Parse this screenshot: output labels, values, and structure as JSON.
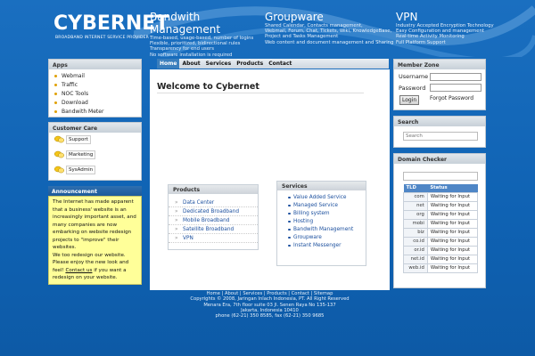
{
  "header": {
    "logo": "CYBERNET",
    "tagline": "BROADBAND INTERNET SERVICE PROVIDER",
    "columns": [
      {
        "title": "Bandwith Management",
        "lines": [
          "Time-based, usage-based, number of logins",
          "Flexible, prioritized, bidirectional rules",
          "Transparency for end users",
          "No software installation is required"
        ]
      },
      {
        "title": "Groupware",
        "lines": [
          "Shared Calendar, Contacts management,",
          "Webmail, Forum, Chat, Tickets, Wiki, KnowledgeBase,",
          "Project and Tasks Management",
          "Web content and document management and Sharing"
        ]
      },
      {
        "title": "VPN",
        "lines": [
          "Industry Accepted Encryption Technology",
          "Easy Configuration and management",
          "Real-time Activity Monitoring",
          "Full Platform Support"
        ]
      }
    ]
  },
  "nav": [
    "Home",
    "About",
    "Services",
    "Products",
    "Contact"
  ],
  "apps": {
    "title": "Apps",
    "items": [
      "Webmail",
      "Traffic",
      "NOC Tools",
      "Download",
      "Bandwith Meter"
    ]
  },
  "care": {
    "title": "Customer Care",
    "items": [
      "Support",
      "Marketing",
      "SysAdmin"
    ]
  },
  "announcement": {
    "title": "Announcement",
    "lines": [
      "The Internet has made apparent",
      "that a business' website is an",
      "increasingly important asset, and",
      "many companies are now",
      "embarking on website redesign",
      "projects to \"improve\" their",
      "websites.",
      "We too redesign our website.",
      "Please enjoy the new look and",
      "feel!"
    ],
    "contact_link": "Contact us",
    "tail": "if you want a",
    "last": "redesign on your website."
  },
  "main": {
    "welcome": "Welcome to Cybernet",
    "products": {
      "title": "Products",
      "items": [
        "Data Center",
        "Dedicated Broadband",
        "Mobile Broadband",
        "Satellite Broadband",
        "VPN"
      ]
    },
    "services": {
      "title": "Services",
      "items": [
        "Value Added Service",
        "Managed Service"
      ],
      "sub": [
        "Billing system",
        "Hosting",
        "Bandwith Management",
        "Groupware",
        "Instant Messenger"
      ]
    }
  },
  "member": {
    "title": "Member Zone",
    "username_label": "Username",
    "password_label": "Password",
    "login": "Login",
    "forgot": "Forgot Password"
  },
  "search": {
    "title": "Search",
    "placeholder": "Search"
  },
  "domain": {
    "title": "Domain Checker",
    "headers": [
      "TLD",
      "Status"
    ],
    "rows": [
      {
        "tld": "com",
        "status": "Waiting for Input"
      },
      {
        "tld": "net",
        "status": "Waiting for Input"
      },
      {
        "tld": "org",
        "status": "Waiting for Input"
      },
      {
        "tld": "mobi",
        "status": "Waiting for Input"
      },
      {
        "tld": "biz",
        "status": "Waiting for Input"
      },
      {
        "tld": "co.id",
        "status": "Waiting for Input"
      },
      {
        "tld": "or.id",
        "status": "Waiting for Input"
      },
      {
        "tld": "net.id",
        "status": "Waiting for Input"
      },
      {
        "tld": "web.id",
        "status": "Waiting for Input"
      }
    ]
  },
  "footer": {
    "links": "Home | About | Services | Products | Contact | Sitemap",
    "copyright": "Copyrights © 2008, Jaringan Inlach Indonesia, PT. All Right Reserved",
    "address1": "Menara Era, 7th floor suite 03 Jl. Senen Raya No 135-137",
    "address2": "Jakarta, Indonesia 10410",
    "phone": "phone (62-21) 350 8585, fax (62-21) 350 9685"
  },
  "colors": {
    "background": "#1a6fc0",
    "nav_active": "#3b7fbd",
    "announcement_bg": "#ffff99",
    "link": "#1b4f9e"
  }
}
